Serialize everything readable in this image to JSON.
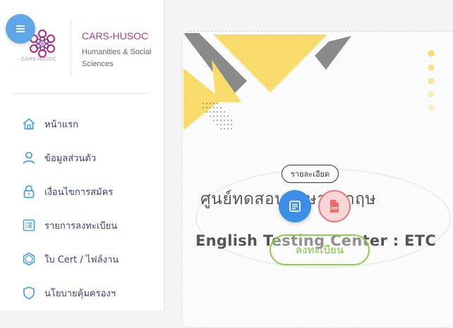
{
  "brand": {
    "title": "CARS-HUSOC",
    "subtitle": "Humanities & Social Sciences",
    "logo_text": "CARS-HUSOC"
  },
  "sidebar": {
    "items": [
      {
        "label": "หน้าแรก",
        "icon": "home-icon"
      },
      {
        "label": "ข้อมูลส่วนตัว",
        "icon": "user-icon"
      },
      {
        "label": "เงื่อนไขการสมัคร",
        "icon": "lock-icon"
      },
      {
        "label": "รายการลงทะเบียน",
        "icon": "list-icon"
      },
      {
        "label": "ใบ Cert / ไฟล์งาน",
        "icon": "gear-icon"
      },
      {
        "label": "นโยบายคุ้มครองฯ",
        "icon": "shield-icon"
      }
    ]
  },
  "card": {
    "badge": "รายละเอียด",
    "title_th": "ศูนย์ทดสอบภาษาอังกฤษ",
    "title_en": "English Testing Center : ETC",
    "register_label": "ลงทะเบียน",
    "pdf_label": "PDF"
  },
  "colors": {
    "brand": "#b4377b",
    "nav_text": "#3a3f6a",
    "nav_icon": "#4aa0e8",
    "accent_yellow": "#f8db6a",
    "accent_gray": "#8a8a8a",
    "detail_button": "#3d8ee6",
    "register_green": "#8ccf4a"
  }
}
